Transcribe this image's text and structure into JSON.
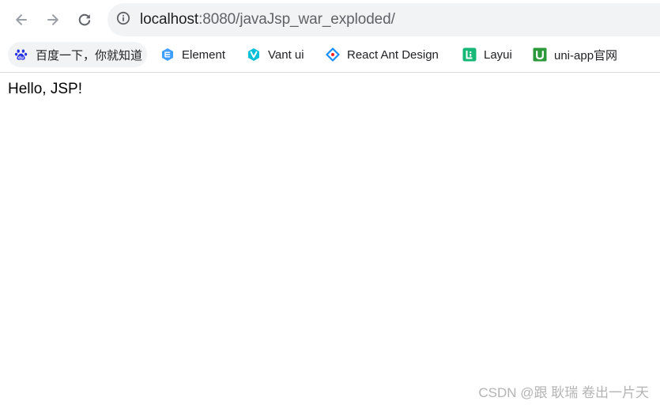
{
  "browser": {
    "nav": {
      "back_icon": "arrow-left-icon",
      "forward_icon": "arrow-right-icon",
      "reload_icon": "reload-icon"
    },
    "address_bar": {
      "info_icon": "info-icon",
      "host": "localhost",
      "path": ":8080/javaJsp_war_exploded/"
    },
    "bookmarks": [
      {
        "label": "百度一下，你就知道",
        "icon": "baidu-paw-icon",
        "color": "#2932e1"
      },
      {
        "label": "Element",
        "icon": "element-icon",
        "color": "#409eff"
      },
      {
        "label": "Vant ui",
        "icon": "vant-icon",
        "color": "#07c1d8"
      },
      {
        "label": "React Ant Design",
        "icon": "ant-design-icon",
        "color": "#1890ff"
      },
      {
        "label": "Layui",
        "icon": "layui-icon",
        "color": "#16b777"
      },
      {
        "label": "uni-app官网",
        "icon": "uni-app-icon",
        "color": "#2b9939"
      }
    ]
  },
  "page": {
    "body_text": "Hello, JSP!"
  },
  "watermark": {
    "text": "CSDN @跟 耿瑞 卷出一片天"
  }
}
